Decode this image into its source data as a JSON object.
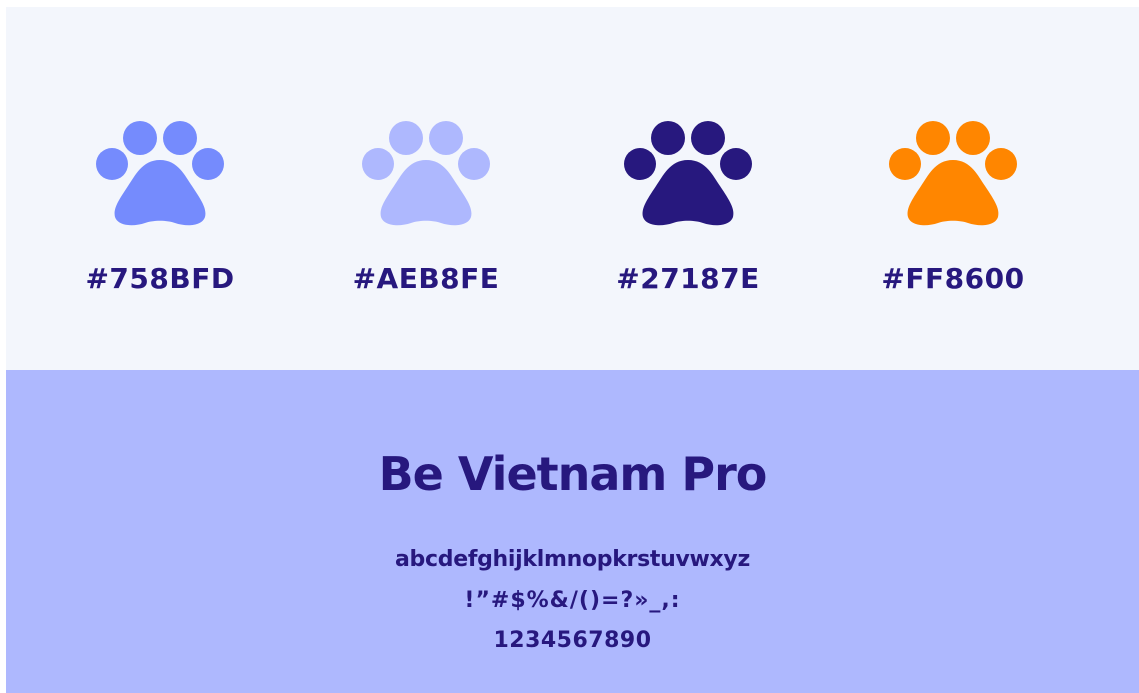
{
  "palette": {
    "swatches": [
      {
        "label": "#758BFD",
        "color": "#758BFD",
        "icon": "paw-icon"
      },
      {
        "label": "#AEB8FE",
        "color": "#AEB8FE",
        "icon": "paw-icon"
      },
      {
        "label": "#27187E",
        "color": "#27187E",
        "icon": "paw-icon"
      },
      {
        "label": "#FF8600",
        "color": "#FF8600",
        "icon": "paw-icon"
      }
    ],
    "background": "#F3F6FC"
  },
  "typography": {
    "font_name": "Be Vietnam Pro",
    "lowercase": "abcdefghijklmnopkrstuvwxyz",
    "symbols": "!”#$%&/()=?»_,:",
    "digits": "1234567890",
    "background": "#AEB8FE",
    "text_color": "#27187E"
  }
}
